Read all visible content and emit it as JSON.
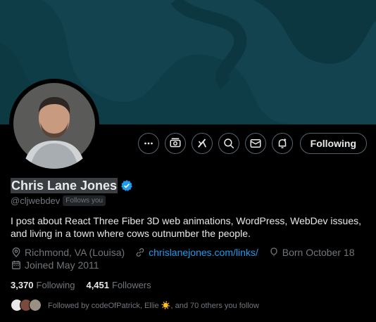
{
  "profile": {
    "name": "Chris Lane Jones",
    "handle": "@cljwebdev",
    "follows_you": "Follows you",
    "bio": "I post about React Three Fiber 3D web animations, WordPress, WebDev issues, and living in a town where cows outnumber the people.",
    "location": "Richmond, VA (Louisa)",
    "website": "chrislanejones.com/links/",
    "born": "Born October 18",
    "joined": "Joined May 2011"
  },
  "stats": {
    "following_count": "3,370",
    "following_label": "Following",
    "followers_count": "4,451",
    "followers_label": "Followers"
  },
  "followed_by": {
    "text": "Followed by codeOfPatrick, Ellie ☀️, and 70 others you follow"
  },
  "actions": {
    "following_label": "Following"
  },
  "colors": {
    "banner": "#0f3d47",
    "accent": "#1d9bf0",
    "text_secondary": "#71767b",
    "border": "#536471"
  },
  "icons": [
    "more-icon",
    "subscribe-icon",
    "grok-icon",
    "search-icon",
    "message-icon",
    "notify-icon",
    "verified-icon",
    "location-icon",
    "link-icon",
    "balloon-icon",
    "calendar-icon"
  ]
}
